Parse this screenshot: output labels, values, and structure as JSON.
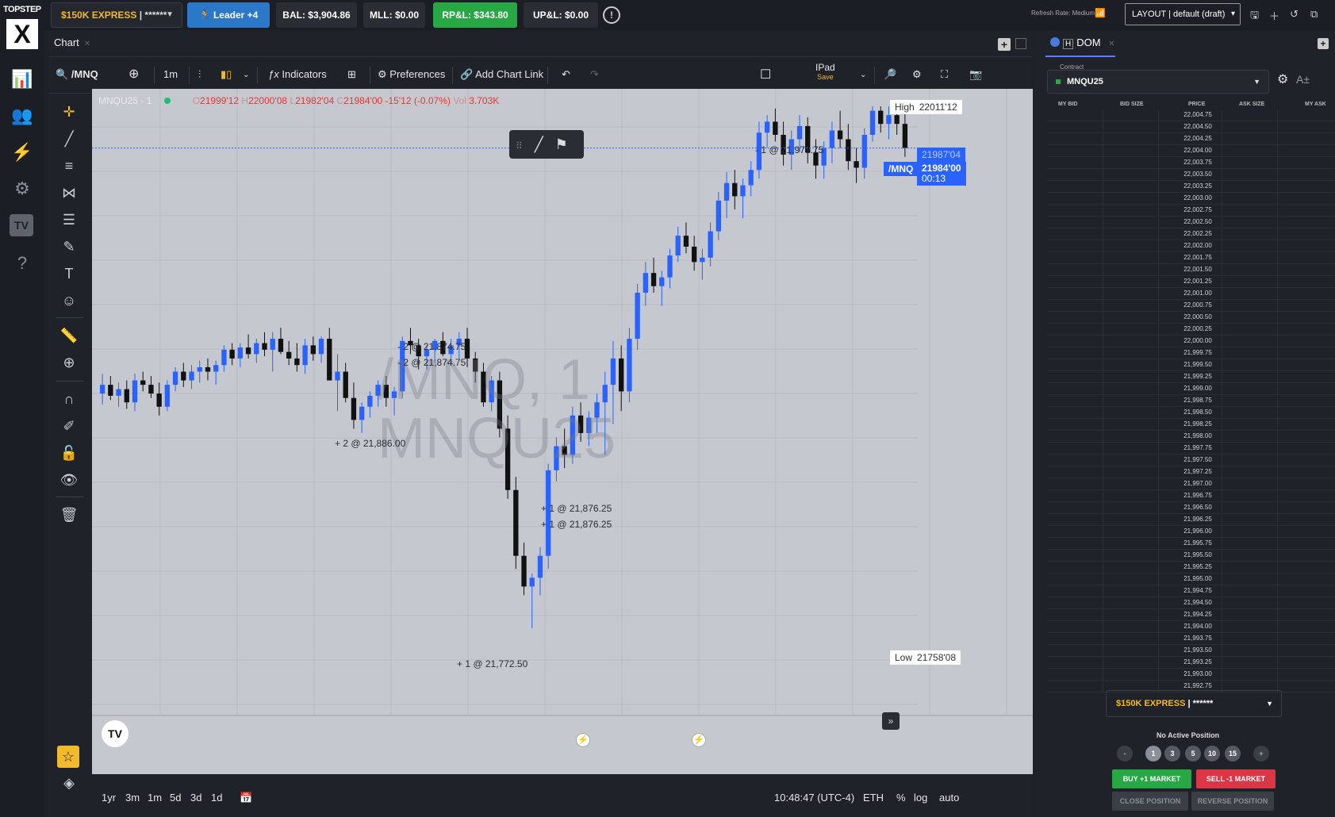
{
  "topbar": {
    "brand": "TOPSTEP",
    "brand_mark": "X",
    "account": {
      "name": "$150K EXPRESS",
      "masked": "| ******"
    },
    "leader": "Leader +4",
    "bal": "BAL: $3,904.86",
    "mll": "MLL: $0.00",
    "rpl": "RP&L: $343.80",
    "upl": "UP&L: $0.00",
    "refresh_rate": "Refresh Rate: Medium",
    "layout": "LAYOUT | default (draft)"
  },
  "chart_panel": {
    "tab_label": "Chart",
    "symbol": "/MNQ",
    "interval": "1m",
    "indicators": "Indicators",
    "preferences": "Preferences",
    "add_chart_link": "Add Chart Link",
    "device_layout": "IPad",
    "device_save": "Save",
    "ohlc": {
      "title": "MNQU25 · 1",
      "open": "21999'12",
      "high": "22000'08",
      "low": "21982'04",
      "close": "21984'00",
      "change": "-15'12 (-0.07%)",
      "vol": "3.703K",
      "o": "O",
      "h": "H",
      "l": "L",
      "c": "C",
      "v": "Vol"
    },
    "watermark_line1": "/MNQ, 1",
    "watermark_line2": "MNQU25",
    "high_label": "High",
    "high_value": "22011'12",
    "low_label": "Low",
    "low_value": "21758'08",
    "price_tag_prev": "21987'04",
    "price_tag_sym": "/MNQ",
    "price_tag_last": "21984'00",
    "price_tag_timer": "00:13",
    "trade_labels": [
      "- 2 @ 21,874.75",
      "- 2 @ 21,874.75",
      "+ 2 @ 21,886.00",
      "+ 1 @ 21,876.25",
      "+ 1 @ 21,876.25",
      "+ 1 @ 21,772.50",
      "- 1 @ 21,971.75"
    ],
    "tv_logo": "TV",
    "timeframes": [
      "1yr",
      "3m",
      "1m",
      "5d",
      "3d",
      "1d"
    ],
    "clock": "10:48:47 (UTC-4)",
    "session": "ETH",
    "pct": "%",
    "log": "log",
    "auto": "auto",
    "icons": [
      "search-icon",
      "plus-circle-icon",
      "bars-icon",
      "candles-icon",
      "fx-icon",
      "grid-icon",
      "gear-icon",
      "link-icon",
      "undo-icon",
      "redo-icon",
      "square-icon",
      "zoom-icon",
      "fullscreen-icon",
      "camera-icon"
    ]
  },
  "dom": {
    "tab_label": "DOM",
    "contract_label": "Contract",
    "contract": "MNQU25",
    "aa_label": "A±",
    "headers": [
      "MY BID",
      "BID SIZE",
      "PRICE",
      "ASK SIZE",
      "MY ASK"
    ],
    "prices": [
      "22,004.75",
      "22,004.50",
      "22,004.25",
      "22,004.00",
      "22,003.75",
      "22,003.50",
      "22,003.25",
      "22,003.00",
      "22,002.75",
      "22,002.50",
      "22,002.25",
      "22,002.00",
      "22,001.75",
      "22,001.50",
      "22,001.25",
      "22,001.00",
      "22,000.75",
      "22,000.50",
      "22,000.25",
      "22,000.00",
      "21,999.75",
      "21,999.50",
      "21,999.25",
      "21,999.00",
      "21,998.75",
      "21,998.50",
      "21,998.25",
      "21,998.00",
      "21,997.75",
      "21,997.50",
      "21,997.25",
      "21,997.00",
      "21,996.75",
      "21,996.50",
      "21,996.25",
      "21,996.00",
      "21,995.75",
      "21,995.50",
      "21,995.25",
      "21,995.00",
      "21,994.75",
      "21,994.50",
      "21,994.25",
      "21,994.00",
      "21,993.75",
      "21,993.50",
      "21,993.25",
      "21,993.00",
      "21,992.75"
    ],
    "account": {
      "name": "$150K EXPRESS",
      "masked": "| ******"
    },
    "no_position": "No Active Position",
    "qty_minus": "-",
    "qty_plus": "+",
    "qty_presets": [
      "1",
      "3",
      "5",
      "10",
      "15"
    ],
    "buy": "BUY +1 MARKET",
    "sell": "SELL -1 MARKET",
    "close": "CLOSE POSITION",
    "reverse": "REVERSE POSITION"
  },
  "colors": {
    "up": "#2962ff",
    "down": "#111111",
    "accent_gold": "#f2b92b",
    "green": "#28a745",
    "red": "#dc3545"
  },
  "chart_data": {
    "type": "candlestick",
    "ylim": [
      21758.5,
      22011.75
    ],
    "candles": [
      [
        21880,
        21889,
        21875,
        21884
      ],
      [
        21884,
        21888,
        21877,
        21879
      ],
      [
        21879,
        21885,
        21874,
        21882
      ],
      [
        21882,
        21886,
        21873,
        21876
      ],
      [
        21876,
        21889,
        21872,
        21886
      ],
      [
        21886,
        21890,
        21881,
        21884
      ],
      [
        21884,
        21888,
        21878,
        21880
      ],
      [
        21880,
        21885,
        21870,
        21874
      ],
      [
        21874,
        21886,
        21872,
        21884
      ],
      [
        21884,
        21892,
        21881,
        21890
      ],
      [
        21890,
        21894,
        21883,
        21886
      ],
      [
        21886,
        21893,
        21882,
        21890
      ],
      [
        21890,
        21895,
        21885,
        21892
      ],
      [
        21892,
        21896,
        21886,
        21890
      ],
      [
        21890,
        21895,
        21884,
        21893
      ],
      [
        21893,
        21902,
        21890,
        21900
      ],
      [
        21900,
        21903,
        21893,
        21896
      ],
      [
        21896,
        21903,
        21892,
        21901
      ],
      [
        21901,
        21907,
        21896,
        21898
      ],
      [
        21898,
        21905,
        21894,
        21903
      ],
      [
        21903,
        21908,
        21897,
        21900
      ],
      [
        21900,
        21908,
        21890,
        21905
      ],
      [
        21905,
        21910,
        21898,
        21899
      ],
      [
        21899,
        21904,
        21893,
        21896
      ],
      [
        21896,
        21903,
        21890,
        21893
      ],
      [
        21893,
        21905,
        21889,
        21902
      ],
      [
        21902,
        21906,
        21895,
        21898
      ],
      [
        21898,
        21906,
        21894,
        21905
      ],
      [
        21905,
        21910,
        21898,
        21886
      ],
      [
        21886,
        21898,
        21872,
        21890
      ],
      [
        21890,
        21894,
        21876,
        21878
      ],
      [
        21878,
        21885,
        21864,
        21868
      ],
      [
        21868,
        21876,
        21862,
        21874
      ],
      [
        21874,
        21881,
        21869,
        21879
      ],
      [
        21879,
        21886,
        21874,
        21884
      ],
      [
        21884,
        21888,
        21874,
        21878
      ],
      [
        21878,
        21883,
        21870,
        21881
      ],
      [
        21881,
        21906,
        21878,
        21904
      ],
      [
        21904,
        21910,
        21898,
        21902
      ],
      [
        21902,
        21905,
        21891,
        21897
      ],
      [
        21897,
        21902,
        21891,
        21900
      ],
      [
        21900,
        21905,
        21894,
        21904
      ],
      [
        21904,
        21908,
        21897,
        21898
      ],
      [
        21898,
        21905,
        21893,
        21902
      ],
      [
        21902,
        21908,
        21896,
        21905
      ],
      [
        21905,
        21910,
        21892,
        21896
      ],
      [
        21896,
        21899,
        21885,
        21890
      ],
      [
        21890,
        21894,
        21874,
        21876
      ],
      [
        21876,
        21888,
        21872,
        21886
      ],
      [
        21886,
        21890,
        21860,
        21864
      ],
      [
        21864,
        21870,
        21832,
        21836
      ],
      [
        21836,
        21842,
        21800,
        21806
      ],
      [
        21806,
        21812,
        21788,
        21792
      ],
      [
        21792,
        21798,
        21773,
        21796
      ],
      [
        21796,
        21810,
        21788,
        21806
      ],
      [
        21806,
        21848,
        21800,
        21845
      ],
      [
        21845,
        21860,
        21840,
        21856
      ],
      [
        21856,
        21864,
        21846,
        21852
      ],
      [
        21852,
        21874,
        21848,
        21870
      ],
      [
        21870,
        21876,
        21858,
        21862
      ],
      [
        21862,
        21872,
        21856,
        21869
      ],
      [
        21869,
        21880,
        21862,
        21876
      ],
      [
        21876,
        21890,
        21852,
        21884
      ],
      [
        21884,
        21904,
        21866,
        21896
      ],
      [
        21896,
        21902,
        21872,
        21881
      ],
      [
        21881,
        21910,
        21876,
        21905
      ],
      [
        21905,
        21930,
        21900,
        21926
      ],
      [
        21926,
        21940,
        21920,
        21935
      ],
      [
        21935,
        21942,
        21926,
        21929
      ],
      [
        21929,
        21936,
        21920,
        21933
      ],
      [
        21933,
        21946,
        21928,
        21943
      ],
      [
        21943,
        21956,
        21940,
        21952
      ],
      [
        21952,
        21958,
        21944,
        21947
      ],
      [
        21947,
        21952,
        21936,
        21940
      ],
      [
        21940,
        21946,
        21932,
        21942
      ],
      [
        21942,
        21958,
        21938,
        21954
      ],
      [
        21954,
        21972,
        21950,
        21968
      ],
      [
        21968,
        21981,
        21960,
        21976
      ],
      [
        21976,
        21982,
        21964,
        21970
      ],
      [
        21970,
        21978,
        21960,
        21975
      ],
      [
        21975,
        21986,
        21970,
        21982
      ],
      [
        21982,
        22004,
        21978,
        21999
      ],
      [
        21999,
        22007,
        21992,
        22004
      ],
      [
        22004,
        22010,
        21995,
        21998
      ],
      [
        21998,
        22004,
        21984,
        21989
      ],
      [
        21989,
        22000,
        21982,
        21996
      ],
      [
        21996,
        22007,
        21990,
        22002
      ],
      [
        22002,
        22006,
        21985,
        21990
      ],
      [
        21990,
        21996,
        21978,
        21984
      ],
      [
        21984,
        21995,
        21978,
        21992
      ],
      [
        21992,
        22004,
        21985,
        22000
      ],
      [
        22000,
        22009,
        21992,
        21996
      ],
      [
        21996,
        22003,
        21982,
        21986
      ],
      [
        21986,
        21992,
        21976,
        21983
      ],
      [
        21983,
        22001,
        21978,
        21998
      ],
      [
        21998,
        22011,
        21995,
        22009
      ],
      [
        22009,
        22011,
        21999,
        22003
      ],
      [
        22003,
        22011,
        21996,
        22007
      ],
      [
        22007,
        22011,
        21998,
        22003
      ],
      [
        22003,
        22008,
        21988,
        21992
      ]
    ]
  }
}
